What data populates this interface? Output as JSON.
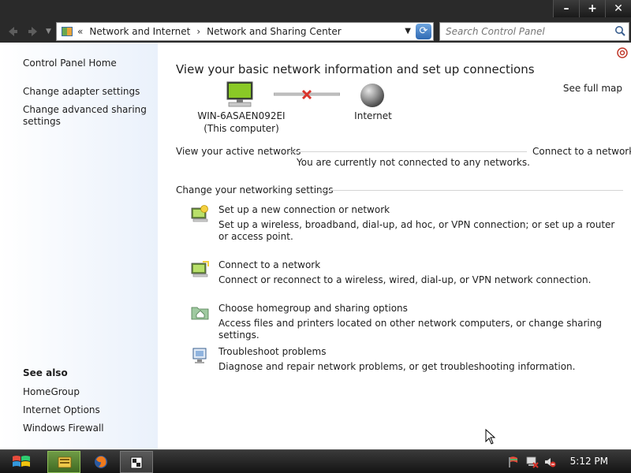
{
  "window": {
    "minimize_label": "–",
    "maximize_label": "+",
    "close_label": "✕"
  },
  "toolbar": {
    "back_icon": "back-arrow-icon",
    "forward_icon": "forward-arrow-icon",
    "breadcrumb_prefix": "«",
    "breadcrumb": [
      "Network and Internet",
      "Network and Sharing Center"
    ],
    "breadcrumb_separator": "›",
    "search_placeholder": "Search Control Panel"
  },
  "sidebar": {
    "links": [
      "Control Panel Home",
      "Change adapter settings",
      "Change advanced sharing settings"
    ],
    "see_also_heading": "See also",
    "see_also": [
      "HomeGroup",
      "Internet Options",
      "Windows Firewall"
    ]
  },
  "main": {
    "title": "View your basic network information and set up connections",
    "see_full_map": "See full map",
    "computer_name": "WIN-6ASAEN092EI",
    "computer_caption": "(This computer)",
    "internet_label": "Internet",
    "active_networks_heading": "View your active networks",
    "connect_link": "Connect to a network",
    "not_connected_text": "You are currently not connected to any networks.",
    "settings_heading": "Change your networking settings",
    "tasks": [
      {
        "title": "Set up a new connection or network",
        "desc": "Set up a wireless, broadband, dial-up, ad hoc, or VPN connection; or set up a router or access point.",
        "icon": "new-connection-icon"
      },
      {
        "title": "Connect to a network",
        "desc": "Connect or reconnect to a wireless, wired, dial-up, or VPN network connection.",
        "icon": "connect-network-icon"
      },
      {
        "title": "Choose homegroup and sharing options",
        "desc": "Access files and printers located on other network computers, or change sharing settings.",
        "icon": "homegroup-icon"
      },
      {
        "title": "Troubleshoot problems",
        "desc": "Diagnose and repair network problems, or get troubleshooting information.",
        "icon": "troubleshoot-icon"
      }
    ]
  },
  "taskbar": {
    "clock": "5:12 PM"
  },
  "colors": {
    "titlebar": "#2a2a2a",
    "sidebar_bg": "#eaf1fb",
    "disconnect_x": "#d9342b"
  }
}
